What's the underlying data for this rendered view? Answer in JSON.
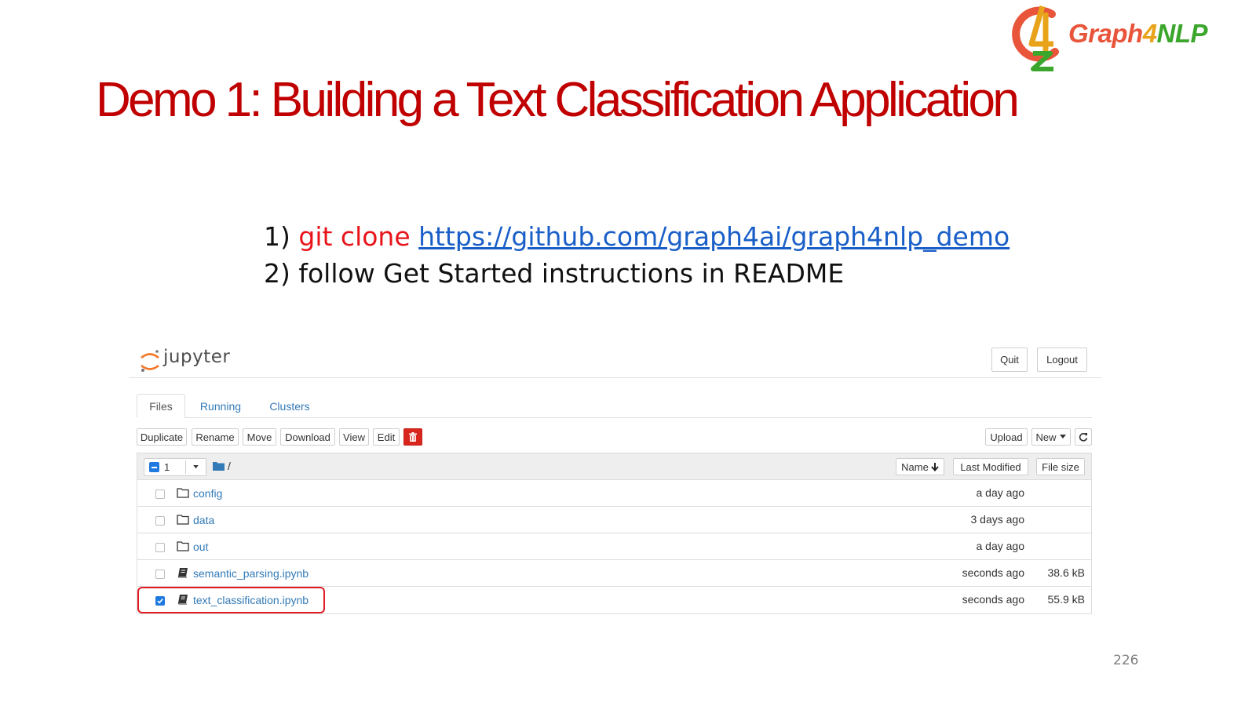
{
  "slide": {
    "title": "Demo 1: Building a Text Classification Application",
    "page_number": "226"
  },
  "logo": {
    "text_part1": "Graph",
    "text_part2": "4",
    "text_part3": "NLP",
    "colors": {
      "graph": "#e8553a",
      "four": "#e8a31a",
      "nlp": "#3aa62b"
    }
  },
  "instructions": {
    "step1_prefix": "1) ",
    "step1_command": "git clone ",
    "step1_link": "https://github.com/graph4ai/graph4nlp_demo",
    "step2": "2) follow Get Started instructions in README"
  },
  "jupyter": {
    "logo_text": "jupyter",
    "header_buttons": {
      "quit": "Quit",
      "logout": "Logout"
    },
    "tabs": [
      {
        "label": "Files",
        "active": true
      },
      {
        "label": "Running",
        "active": false
      },
      {
        "label": "Clusters",
        "active": false
      }
    ],
    "toolbar": {
      "duplicate": "Duplicate",
      "rename": "Rename",
      "move": "Move",
      "download": "Download",
      "view": "View",
      "edit": "Edit",
      "delete_icon": "trash-icon",
      "upload": "Upload",
      "new": "New",
      "refresh_icon": "refresh-icon"
    },
    "list_header": {
      "selected_count": "1",
      "path": "/",
      "sort_name": "Name",
      "last_modified": "Last Modified",
      "file_size": "File size"
    },
    "files": [
      {
        "name": "config",
        "type": "folder",
        "modified": "a day ago",
        "size": "",
        "checked": false
      },
      {
        "name": "data",
        "type": "folder",
        "modified": "3 days ago",
        "size": "",
        "checked": false
      },
      {
        "name": "out",
        "type": "folder",
        "modified": "a day ago",
        "size": "",
        "checked": false
      },
      {
        "name": "semantic_parsing.ipynb",
        "type": "notebook",
        "modified": "seconds ago",
        "size": "38.6 kB",
        "checked": false
      },
      {
        "name": "text_classification.ipynb",
        "type": "notebook",
        "modified": "seconds ago",
        "size": "55.9 kB",
        "checked": true
      }
    ],
    "colors": {
      "link": "#337ab7",
      "accent": "#1f7ae0",
      "delete": "#d9261c",
      "highlight": "#e01b24"
    }
  }
}
